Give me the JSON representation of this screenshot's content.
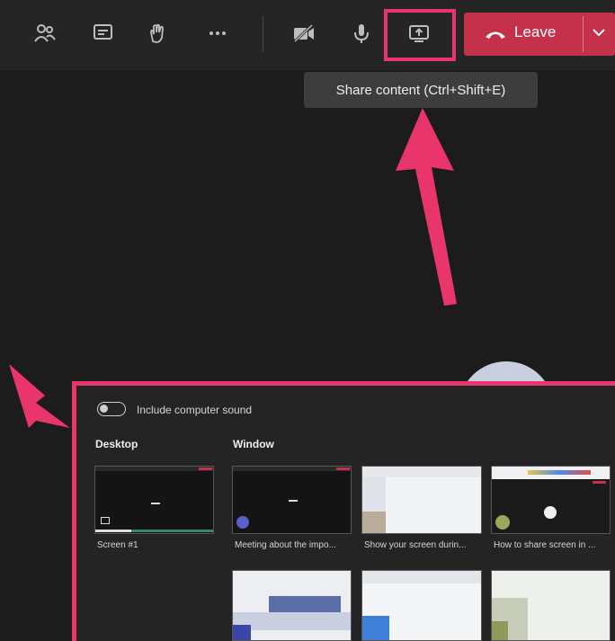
{
  "toolbar": {
    "items": [
      "people-icon",
      "chat-icon",
      "raise-hand-icon",
      "more-icon",
      "camera-off-icon",
      "microphone-icon",
      "share-icon"
    ],
    "leave_label": "Leave"
  },
  "tooltip": {
    "text": "Share content (Ctrl+Shift+E)"
  },
  "share_panel": {
    "include_sound_label": "Include computer sound",
    "include_sound_on": false,
    "desktop_heading": "Desktop",
    "window_heading": "Window",
    "desktop_items": [
      {
        "caption": "Screen #1"
      }
    ],
    "window_items": [
      {
        "caption": "Meeting about the impo..."
      },
      {
        "caption": "Show your screen durin..."
      },
      {
        "caption": "How to share screen in ..."
      }
    ]
  },
  "colors": {
    "accent": "#e8356b",
    "leave": "#c4314b",
    "background": "#1c1c1c"
  }
}
